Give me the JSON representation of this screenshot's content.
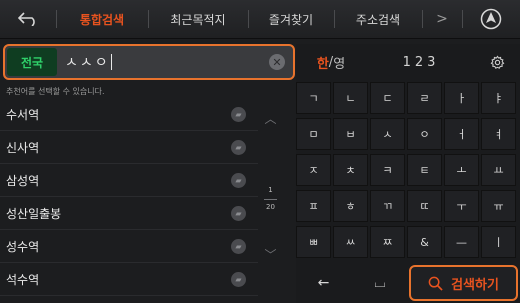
{
  "tabs": {
    "items": [
      "통합검색",
      "최근목적지",
      "즐겨찾기",
      "주소검색"
    ],
    "more": ">"
  },
  "search": {
    "region": "전국",
    "query": "ㅅㅅㅇ",
    "clear": "✕"
  },
  "suggestions": {
    "hint": "추천어를 선택할 수 있습니다.",
    "items": [
      "수서역",
      "신사역",
      "삼성역",
      "성산일출봉",
      "성수역",
      "석수역"
    ],
    "page_current": "1",
    "page_total": "20"
  },
  "keyboard": {
    "mode_korean": "한",
    "mode_sep": "/",
    "mode_english": "영",
    "mode_numbers": "123",
    "rows": [
      [
        "ㄱ",
        "ㄴ",
        "ㄷ",
        "ㄹ",
        "ㅏ",
        "ㅑ"
      ],
      [
        "ㅁ",
        "ㅂ",
        "ㅅ",
        "ㅇ",
        "ㅓ",
        "ㅕ"
      ],
      [
        "ㅈ",
        "ㅊ",
        "ㅋ",
        "ㅌ",
        "ㅗ",
        "ㅛ"
      ],
      [
        "ㅍ",
        "ㅎ",
        "ㄲ",
        "ㄸ",
        "ㅜ",
        "ㅠ"
      ],
      [
        "ㅃ",
        "ㅆ",
        "ㅉ",
        "&",
        "—",
        "ㅣ"
      ]
    ],
    "backspace": "←",
    "space": "⌴",
    "search_label": "검색하기"
  },
  "icons": {
    "back": "back-arrow-icon",
    "navigation": "navigation-arrow-icon",
    "gear": "gear-icon",
    "search": "search-icon"
  },
  "colors": {
    "accent": "#e8531f",
    "highlight_border": "#e8732d",
    "region_text": "#2fd06a",
    "background": "#1c1d1f"
  }
}
